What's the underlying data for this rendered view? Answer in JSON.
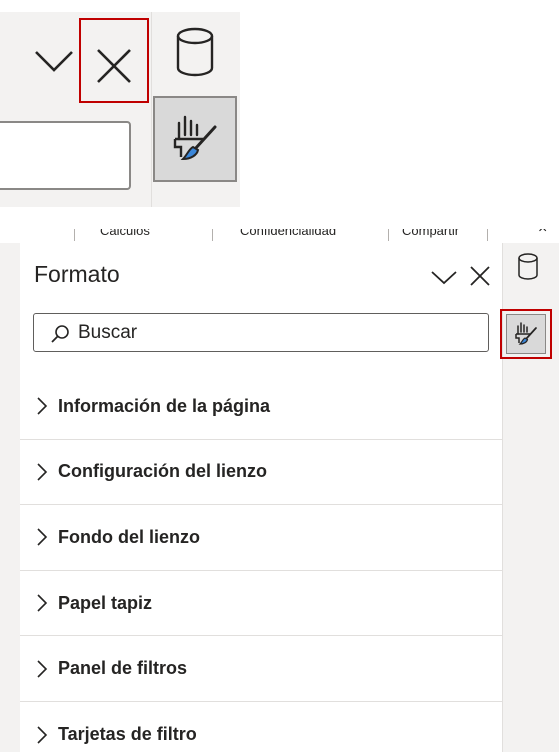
{
  "zoom": {
    "icons": [
      "chevron-down-icon",
      "close-icon",
      "cylinder-icon",
      "format-paintbrush-icon"
    ]
  },
  "tabs": {
    "items": [
      "Cálculos",
      "Confidencialidad",
      "Compartir"
    ],
    "close_glyph": "×"
  },
  "format_pane": {
    "title": "Formato",
    "search_placeholder": "Buscar",
    "sections": [
      "Información de la página",
      "Configuración del lienzo",
      "Fondo del lienzo",
      "Papel tapiz",
      "Panel de filtros",
      "Tarjetas de filtro"
    ]
  },
  "colors": {
    "highlight": "#c00000",
    "pane_bg": "#ffffff",
    "shade": "#f3f2f1",
    "brush_accent": "#3a86d8"
  }
}
